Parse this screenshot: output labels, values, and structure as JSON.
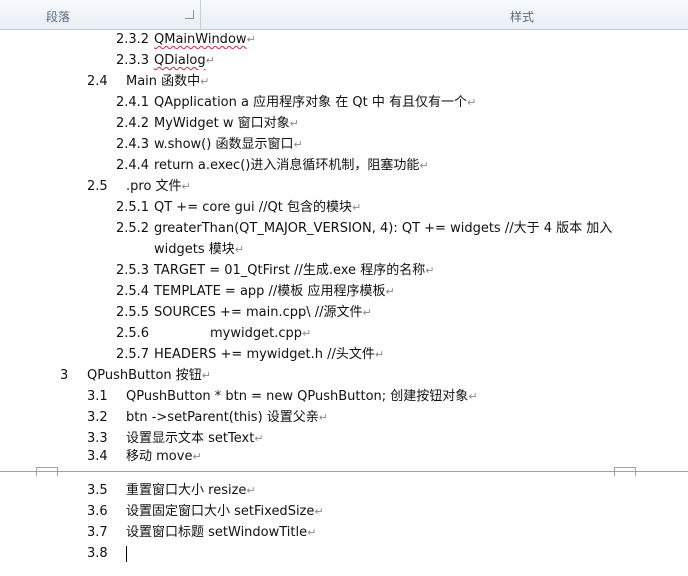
{
  "ribbon": {
    "paragraph_group": "段落",
    "styles_group": "样式"
  },
  "mark": "↵",
  "lines": [
    {
      "id": "l232",
      "num": "2.3.2",
      "text": "QMainWindow"
    },
    {
      "id": "l233",
      "num": "2.3.3",
      "text": "QDialog"
    },
    {
      "id": "l24",
      "num": "2.4",
      "text": "Main 函数中"
    },
    {
      "id": "l241",
      "num": "2.4.1",
      "text": "QApplication a    应用程序对象    在 Qt 中  有且仅有一个"
    },
    {
      "id": "l242",
      "num": "2.4.2",
      "text": "MyWidget w  窗口对象"
    },
    {
      "id": "l243",
      "num": "2.4.3",
      "text": "w.show()  函数显示窗口"
    },
    {
      "id": "l244",
      "num": "2.4.4",
      "text": "return    a.exec()进入消息循环机制，阻塞功能"
    },
    {
      "id": "l25",
      "num": "2.5",
      "text": ".pro 文件"
    },
    {
      "id": "l251",
      "num": "2.5.1",
      "text": "QT              += core gui            //Qt 包含的模块"
    },
    {
      "id": "l252",
      "num": "2.5.2",
      "text": "greaterThan(QT_MAJOR_VERSION, 4): QT += widgets        //大于 4 版本    加入"
    },
    {
      "id": "l252b",
      "num": "",
      "text": "widgets      模块"
    },
    {
      "id": "l253",
      "num": "2.5.3",
      "text": "TARGET = 01_QtFirst      //生成.exe 程序的名称"
    },
    {
      "id": "l254",
      "num": "2.5.4",
      "text": "TEMPLATE = app               //模板  应用程序模板"
    },
    {
      "id": "l255",
      "num": "2.5.5",
      "text": "SOURCES += main.cpp\\       //源文件"
    },
    {
      "id": "l256",
      "num": "2.5.6",
      "text": "mywidget.cpp"
    },
    {
      "id": "l257",
      "num": "2.5.7",
      "text": "HEADERS    += mywidget.h    //头文件"
    },
    {
      "id": "l3",
      "num": "3",
      "text": "QPushButton 按钮"
    },
    {
      "id": "l31",
      "num": "3.1",
      "text": "QPushButton * btn = new QPushButton;    创建按钮对象"
    },
    {
      "id": "l32",
      "num": "3.2",
      "text": "btn ->setParent(this) 设置父亲"
    },
    {
      "id": "l33",
      "num": "3.3",
      "text": "设置显示文本  setText"
    },
    {
      "id": "l34",
      "num": "3.4",
      "text": "移动        move"
    },
    {
      "id": "l35",
      "num": "3.5",
      "text": "重置窗口大小     resize"
    },
    {
      "id": "l36",
      "num": "3.6",
      "text": "设置固定窗口大小       setFixedSize"
    },
    {
      "id": "l37",
      "num": "3.7",
      "text": "设置窗口标题       setWindowTitle"
    },
    {
      "id": "l38",
      "num": "3.8",
      "text": ""
    }
  ]
}
